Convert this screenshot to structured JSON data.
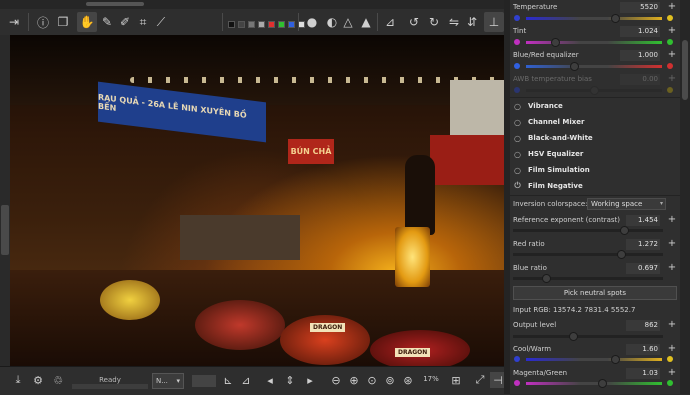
{
  "toolbar": {
    "icons": [
      "dock-icon",
      "info-icon",
      "before-after-icon",
      "hand-icon",
      "color-picker-icon",
      "wb-picker-icon",
      "crop-icon",
      "straighten-icon",
      "swatch-row",
      "ball-icon",
      "circle-icon",
      "warning-icon",
      "warning-filled-icon",
      "histogram-icon",
      "rotate-left-icon",
      "rotate-right-icon",
      "flip-h-icon",
      "flip-v-icon",
      "panel-toggle-icon"
    ],
    "swatch_colors": [
      "#111111",
      "#444444",
      "#777777",
      "#aaaaaa",
      "#e03030",
      "#30c030",
      "#3060e0",
      "#dddddd"
    ]
  },
  "preview": {
    "sign_text": "RAU QUẢ - 26A LÊ NIN XUYÊN BỒ BẾN",
    "sign2_text": "BÚN CHẢ",
    "label1": "DRAGON",
    "label2": "DRAGON"
  },
  "bottombar": {
    "status": "Ready",
    "profile_dropdown": "N...",
    "zoom": "17%"
  },
  "panel": {
    "temperature": {
      "label": "Temperature",
      "value": "5520",
      "level": 0.66
    },
    "tint": {
      "label": "Tint",
      "value": "1.024",
      "level": 0.22
    },
    "blue_red": {
      "label": "Blue/Red equalizer",
      "value": "1.000",
      "level": 0.36
    },
    "awb_bias": {
      "label": "AWB temperature bias",
      "value": "0.00",
      "level": 0.5
    },
    "tools": [
      {
        "label": "Vibrance",
        "power": "○"
      },
      {
        "label": "Channel Mixer",
        "power": "○"
      },
      {
        "label": "Black-and-White",
        "power": "○"
      },
      {
        "label": "HSV Equalizer",
        "power": "○"
      },
      {
        "label": "Film Simulation",
        "power": "○"
      },
      {
        "label": "Film Negative",
        "power": "⏻"
      }
    ],
    "inversion_label": "Inversion colorspace:",
    "inversion_value": "Working space",
    "ref_exponent": {
      "label": "Reference exponent (contrast)",
      "value": "1.454",
      "level": 0.74
    },
    "red_ratio": {
      "label": "Red ratio",
      "value": "1.272",
      "level": 0.72
    },
    "blue_ratio": {
      "label": "Blue ratio",
      "value": "0.697",
      "level": 0.22
    },
    "pick_button": "Pick neutral spots",
    "input_rgb": "Input RGB: 13574.2 7831.4 5552.7",
    "output_level": {
      "label": "Output level",
      "value": "862",
      "level": 0.4
    },
    "cool_warm": {
      "label": "Cool/Warm",
      "value": "1.60",
      "level": 0.66
    },
    "magenta_green": {
      "label": "Magenta/Green",
      "value": "1.03",
      "level": 0.56
    }
  }
}
